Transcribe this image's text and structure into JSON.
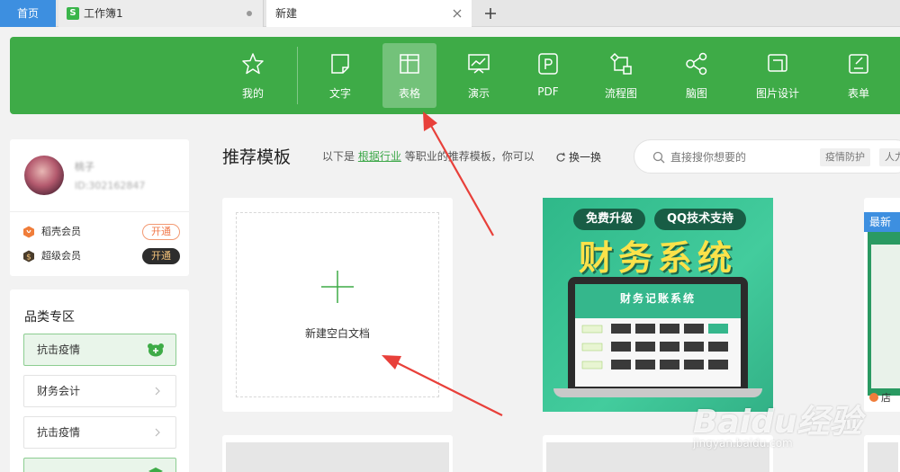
{
  "tabbar": {
    "home": "首页",
    "workbook": "工作簿1",
    "workbook_icon": "S",
    "new_tab": "新建"
  },
  "toolbar": {
    "items": [
      {
        "label": "我的",
        "icon": "star-icon"
      },
      {
        "label": "文字",
        "icon": "document-icon"
      },
      {
        "label": "表格",
        "icon": "spreadsheet-icon",
        "active": true
      },
      {
        "label": "演示",
        "icon": "presentation-icon"
      },
      {
        "label": "PDF",
        "icon": "pdf-icon"
      },
      {
        "label": "流程图",
        "icon": "flowchart-icon"
      },
      {
        "label": "脑图",
        "icon": "mindmap-icon"
      },
      {
        "label": "图片设计",
        "icon": "image-design-icon"
      },
      {
        "label": "表单",
        "icon": "form-icon"
      }
    ]
  },
  "user": {
    "name": "桃子",
    "id": "ID:302162847",
    "memberships": [
      {
        "label": "稻壳会员",
        "button": "开通"
      },
      {
        "label": "超级会员",
        "button": "开通"
      }
    ]
  },
  "categories": {
    "title": "品类专区",
    "items": [
      {
        "label": "抗击疫情"
      },
      {
        "label": "财务会计"
      },
      {
        "label": "抗击疫情"
      }
    ]
  },
  "main": {
    "title": "推荐模板",
    "desc_prefix": "以下是",
    "desc_link": "根据行业",
    "desc_suffix": "等职业的推荐模板，你可以",
    "refresh": "换一换",
    "search_placeholder": "直接搜你想要的",
    "chips": [
      "疫情防护",
      "人力"
    ],
    "new_blank": "新建空白文档"
  },
  "templates": {
    "finance": {
      "pill1": "免费升级",
      "pill2": "QQ技术支持",
      "title": "财务系统",
      "screen_title": "财务记账系统"
    },
    "third": {
      "badge": "最新",
      "footer": "店"
    }
  },
  "watermark": {
    "text": "Baidu经验",
    "url": "jingyan.baidu.com"
  },
  "colors": {
    "green": "#3eab47",
    "blue": "#3d8fe0",
    "arrow": "#e8403a"
  }
}
